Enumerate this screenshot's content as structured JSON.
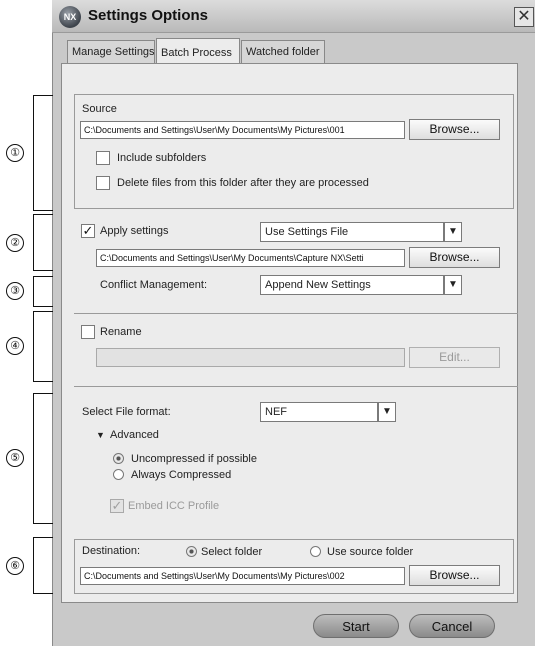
{
  "window": {
    "logo_text": "NX",
    "title": "Settings Options",
    "close_glyph": "✕"
  },
  "tabs": [
    {
      "label": "Manage Settings"
    },
    {
      "label": "Batch Process"
    },
    {
      "label": "Watched folder"
    }
  ],
  "source": {
    "label": "Source",
    "path": "C:\\Documents and Settings\\User\\My Documents\\My Pictures\\001",
    "browse_label": "Browse...",
    "include_subfolders_label": "Include subfolders",
    "delete_files_label": "Delete files from this folder after they are processed"
  },
  "apply": {
    "label": "Apply settings",
    "check_glyph": "✓",
    "mode": "Use Settings File",
    "path": "C:\\Documents and Settings\\User\\My Documents\\Capture NX\\Setti",
    "browse_label": "Browse..."
  },
  "conflict": {
    "label": "Conflict Management:",
    "value": "Append New Settings"
  },
  "rename": {
    "label": "Rename",
    "edit_label": "Edit..."
  },
  "format": {
    "label": "Select File format:",
    "value": "NEF",
    "advanced_label": "Advanced",
    "advanced_glyph": "▼",
    "uncompressed_label": "Uncompressed if possible",
    "compressed_label": "Always Compressed",
    "embed_icc_label": "Embed ICC Profile",
    "embed_glyph": "✓"
  },
  "destination": {
    "label": "Destination:",
    "select_folder_label": "Select folder",
    "use_source_label": "Use source folder",
    "path": "C:\\Documents and Settings\\User\\My Documents\\My Pictures\\002",
    "browse_label": "Browse..."
  },
  "footer": {
    "start_label": "Start",
    "cancel_label": "Cancel"
  },
  "dropdown_glyph": "▼",
  "callouts": [
    "①",
    "②",
    "③",
    "④",
    "⑤",
    "⑥"
  ]
}
